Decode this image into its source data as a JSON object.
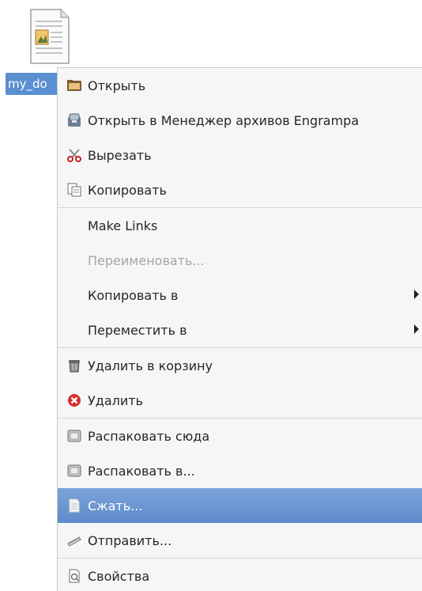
{
  "desktop": {
    "file_label": "my_do"
  },
  "menu": {
    "items": [
      {
        "label": "Открыть",
        "icon": "folder-open-icon"
      },
      {
        "label": "Открыть в Менеджер архивов Engrampa",
        "icon": "archive-manager-icon"
      },
      {
        "label": "Вырезать",
        "icon": "scissors-icon"
      },
      {
        "label": "Копировать",
        "icon": "copy-icon"
      },
      {
        "label": "Make Links",
        "icon": ""
      },
      {
        "label": "Переименовать...",
        "icon": "",
        "disabled": true
      },
      {
        "label": "Копировать в",
        "icon": "",
        "submenu": true
      },
      {
        "label": "Переместить в",
        "icon": "",
        "submenu": true
      },
      {
        "label": "Удалить в корзину",
        "icon": "trash-icon"
      },
      {
        "label": "Удалить",
        "icon": "delete-icon"
      },
      {
        "label": "Распаковать сюда",
        "icon": "extract-icon"
      },
      {
        "label": "Распаковать в...",
        "icon": "extract-icon"
      },
      {
        "label": "Сжать...",
        "icon": "document-icon",
        "highlighted": true
      },
      {
        "label": "Отправить...",
        "icon": "send-icon"
      },
      {
        "label": "Свойства",
        "icon": "properties-icon"
      }
    ]
  },
  "colors": {
    "highlight": "#6593d0",
    "selection_label": "#5a8fd0"
  }
}
